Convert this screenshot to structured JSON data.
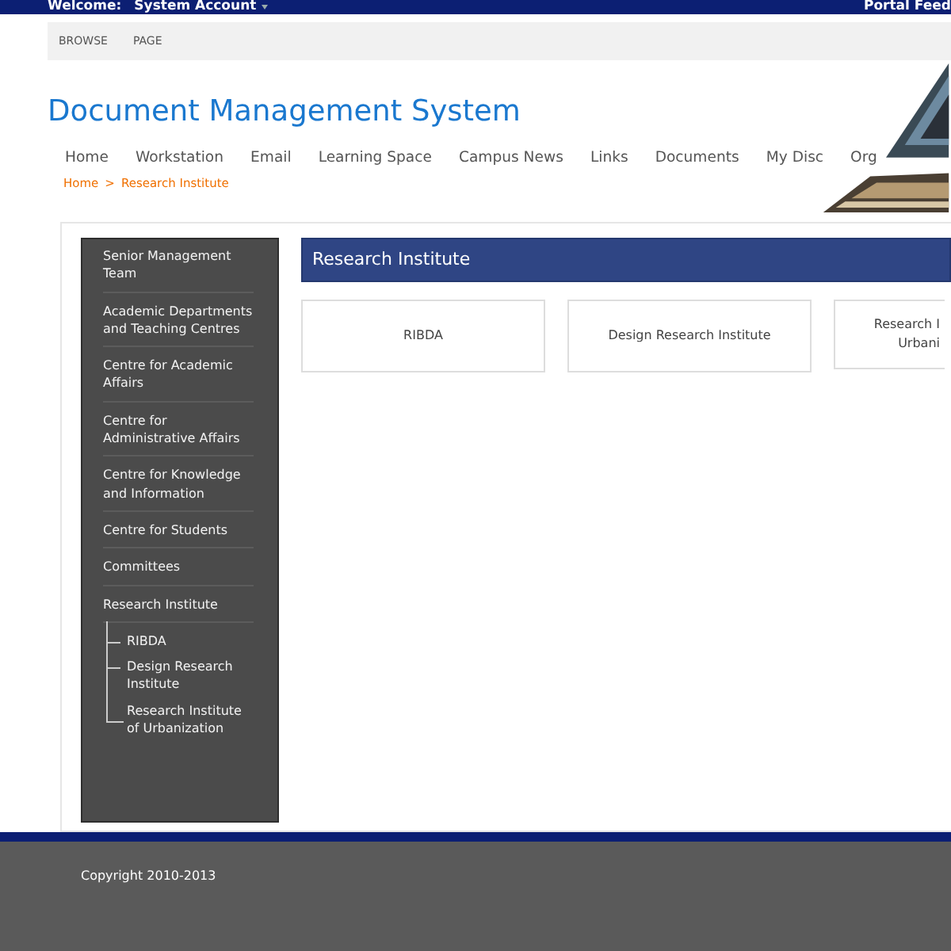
{
  "top_bar": {
    "welcome": "Welcome:",
    "user": "System Account",
    "right_link": "Portal Feed"
  },
  "ribbon": {
    "tabs": [
      {
        "label": "BROWSE",
        "selected": false
      },
      {
        "label": "PAGE",
        "selected": false
      }
    ]
  },
  "site_title": "Document Management System",
  "nav": [
    "Home",
    "Workstation",
    "Email",
    "Learning Space",
    "Campus News",
    "Links",
    "Documents",
    "My Disc",
    "Org"
  ],
  "breadcrumb": {
    "items": [
      "Home",
      "Research Institute"
    ],
    "separator": ">"
  },
  "sidebar": {
    "items": [
      {
        "label": "Senior Management Team"
      },
      {
        "label": "Academic Departments and Teaching Centres"
      },
      {
        "label": "Centre for Academic Affairs"
      },
      {
        "label": "Centre for Administrative Affairs"
      },
      {
        "label": "Centre for Knowledge and Information"
      },
      {
        "label": "Centre for Students"
      },
      {
        "label": "Committees"
      },
      {
        "label": "Research Institute",
        "children": [
          {
            "label": "RIBDA"
          },
          {
            "label": "Design Research Institute"
          },
          {
            "label": "Research Institute of Urbanization"
          }
        ]
      }
    ]
  },
  "section": {
    "title": "Research Institute",
    "tiles": [
      {
        "kind": "full",
        "lines": [
          "RIBDA"
        ]
      },
      {
        "kind": "full",
        "lines": [
          "Design Research Institute"
        ]
      },
      {
        "kind": "partial",
        "lines": [
          "Research I",
          "Urbani"
        ]
      }
    ]
  },
  "footer": {
    "copyright": "Copyright 2010-2013"
  }
}
